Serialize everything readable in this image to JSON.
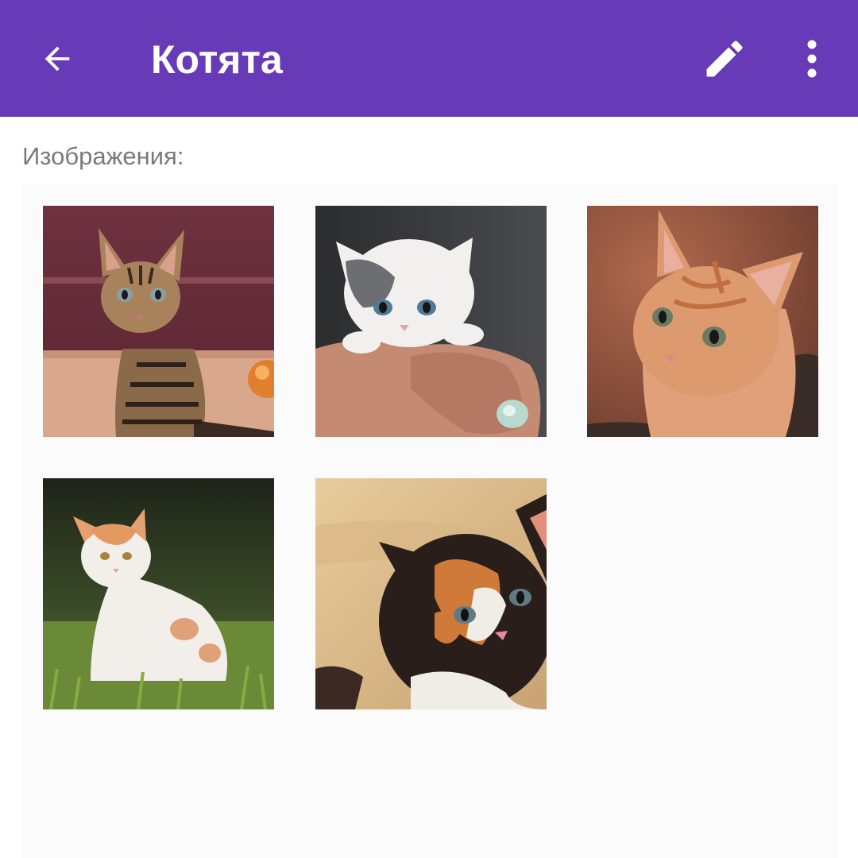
{
  "appbar": {
    "title": "Котята",
    "background_color": "#673ab7",
    "back_icon": "arrow-back-icon",
    "edit_icon": "pencil-icon",
    "more_icon": "more-vert-icon"
  },
  "content": {
    "images_label": "Изображения:",
    "images": [
      {
        "subject": "tabby-kitten-photo"
      },
      {
        "subject": "white-gray-kitten-in-hand-photo"
      },
      {
        "subject": "orange-kitten-photo"
      },
      {
        "subject": "white-orange-kitten-in-grass-photo"
      },
      {
        "subject": "calico-kitten-photo"
      }
    ]
  }
}
